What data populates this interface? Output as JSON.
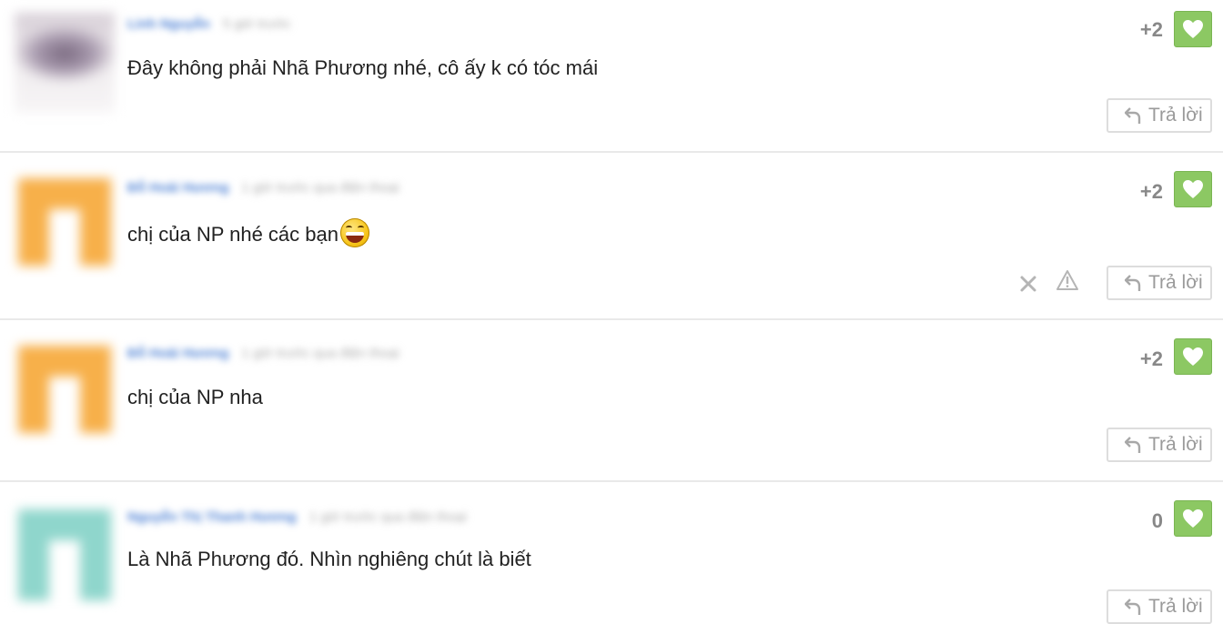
{
  "comments": [
    {
      "author": "Linh Nguyễn",
      "time": "5 giờ trước",
      "text": "Đây không phải Nhã Phương nhé, cô ấy k có tóc mái",
      "score": "+2",
      "reply_label": "Trả lời"
    },
    {
      "author": "Đỗ Hoài Hương",
      "time": "1 giờ trước qua điện thoại",
      "text": "chị của NP nhé các bạn",
      "score": "+2",
      "reply_label": "Trả lời",
      "emoji": "laughing-emoji"
    },
    {
      "author": "Đỗ Hoài Hương",
      "time": "1 giờ trước qua điện thoại",
      "text": "chị của NP nha",
      "score": "+2",
      "reply_label": "Trả lời"
    },
    {
      "author": "Nguyễn Thị Thanh Hương",
      "time": "1 giờ trước qua điện thoại",
      "text": "Là Nhã Phương đó. Nhìn nghiêng chút là biết",
      "score": "0",
      "reply_label": "Trả lời"
    }
  ],
  "icons": {
    "like": "heart-icon",
    "reply": "reply-arrow-icon",
    "delete": "close-icon",
    "report": "warning-icon"
  },
  "colors": {
    "like_button": "#8cc863",
    "author_link": "#4a7fd4",
    "score": "#888888",
    "divider": "#e9e9e9"
  }
}
